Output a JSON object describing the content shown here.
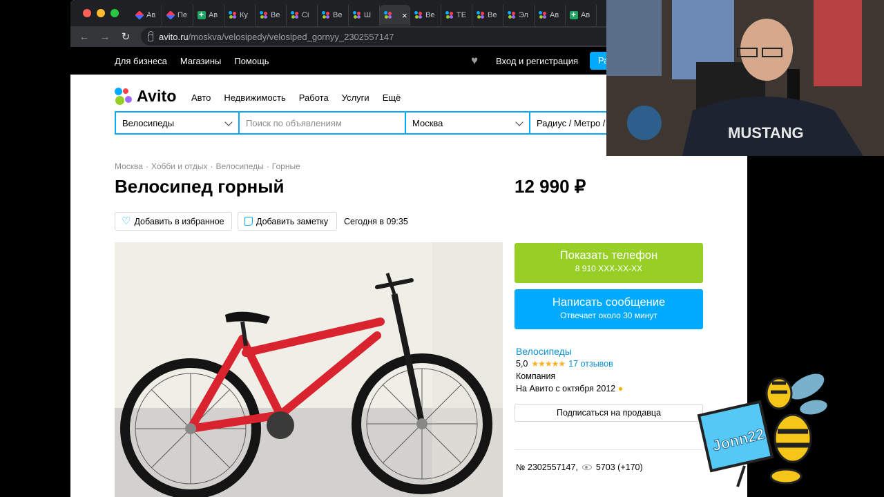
{
  "browser": {
    "tabs": [
      {
        "label": "Ав",
        "icon": "avito-diamond-icon"
      },
      {
        "label": "Пе",
        "icon": "avito-diamond-icon"
      },
      {
        "label": "Ав",
        "icon": "sheets-icon"
      },
      {
        "label": "Ку",
        "icon": "avito-icon"
      },
      {
        "label": "Ве",
        "icon": "avito-icon"
      },
      {
        "label": "Сі",
        "icon": "avito-icon"
      },
      {
        "label": "Ве",
        "icon": "avito-icon"
      },
      {
        "label": "Ш",
        "icon": "avito-icon"
      },
      {
        "label": "",
        "icon": "avito-icon",
        "active": true
      },
      {
        "label": "Ве",
        "icon": "avito-icon"
      },
      {
        "label": "ТЕ",
        "icon": "avito-icon"
      },
      {
        "label": "Ве",
        "icon": "avito-icon"
      },
      {
        "label": "Эл",
        "icon": "avito-icon"
      },
      {
        "label": "Ав",
        "icon": "avito-icon"
      },
      {
        "label": "Ав",
        "icon": "sheets-icon"
      }
    ],
    "url_host": "avito.ru",
    "url_path": "/moskva/velosipedy/velosiped_gornyy_2302557147"
  },
  "topbar": {
    "links": [
      "Для бизнеса",
      "Магазины",
      "Помощь"
    ],
    "login": "Вход и регистрация",
    "post_button": "Ра"
  },
  "header": {
    "logo_text": "Avito",
    "categories": [
      "Авто",
      "Недвижимость",
      "Работа",
      "Услуги",
      "Ещё"
    ]
  },
  "search": {
    "category": "Велосипеды",
    "query_placeholder": "Поиск по объявлениям",
    "city": "Москва",
    "radius": "Радиус / Метро / Р"
  },
  "item": {
    "breadcrumbs": [
      "Москва",
      "Хобби и отдых",
      "Велосипеды",
      "Горные"
    ],
    "title": "Велосипед горный",
    "price": "12 990 ₽",
    "fav_button": "Добавить в избранное",
    "note_button": "Добавить заметку",
    "posted": "Сегодня в 09:35"
  },
  "contact": {
    "phone_button": "Показать телефон",
    "phone_masked": "8 910 XXX-XX-XX",
    "message_button": "Написать сообщение",
    "message_sub": "Отвечает около 30 минут"
  },
  "seller": {
    "name": "Велосипеды",
    "rating": "5,0",
    "stars": "★★★★★",
    "reviews": "17 отзывов",
    "type": "Компания",
    "since": "На Авито с октября 2012",
    "subscribe_button": "Подписаться на продавца"
  },
  "stats": {
    "ad_number": "№ 2302557147,",
    "views": "5703 (+170)"
  },
  "overlay": {
    "sticker_text": "Jonn22"
  },
  "colors": {
    "accent": "#00aaff",
    "green": "#97cf26",
    "bike_red": "#d9232e"
  }
}
